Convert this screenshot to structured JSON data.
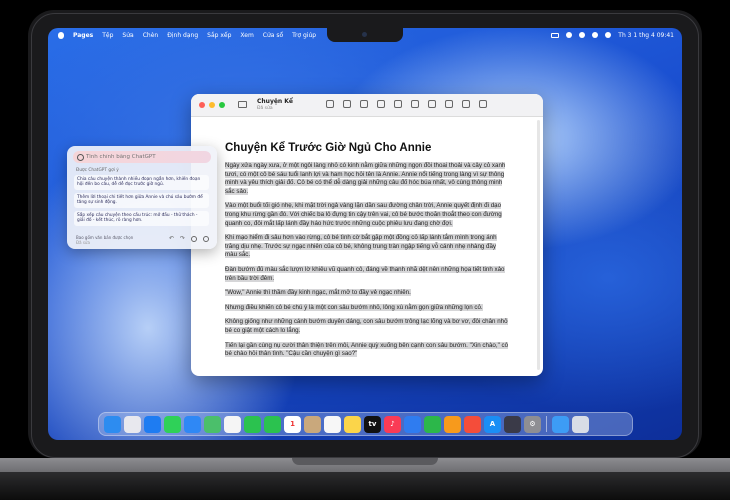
{
  "menubar": {
    "app": "Pages",
    "items": [
      "Tệp",
      "Sửa",
      "Chèn",
      "Định dạng",
      "Sắp xếp",
      "Xem",
      "Cửa sổ",
      "Trợ giúp"
    ],
    "clock": "Th 3 1 thg 4  09:41"
  },
  "window": {
    "title": "Chuyện Kể",
    "subtitle": "Đã sửa",
    "heading": "Chuyện Kể Trước Giờ Ngủ Cho Annie",
    "paragraphs": [
      "Ngày xửa ngày xưa, ở một ngôi làng nhỏ có kinh nằm giữa những ngọn đồi thoai thoải và cây cỏ xanh tươi, có một cô bé sáu tuổi lanh lợi và ham học hỏi tên là Annie. Annie nổi tiếng trong làng vì sự thông minh và yêu thích giải đố. Cô bé có thể dễ dàng giải những câu đố hóc búa nhất, vô cùng thông minh sắc sảo.",
      "Vào một buổi tối gió nhẹ, khi mặt trời ngả vàng lặn dần sau đường chân trời, Annie quyết định đi dạo trong khu rừng gần đó. Với chiếc ba lô đựng tin cậy trên vai, cô bé bước thoăn thoắt theo con đường quanh co, đôi mắt lấp lánh đầy háo hức trước những cuộc phiêu lưu đang chờ đợi.",
      "Khi mạo hiểm đi sâu hơn vào rừng, cô bé tình cờ bắt gặp một đồng cỏ lấp lánh tắm mình trong ánh trăng dịu nhẹ. Trước sự ngạc nhiên của cô bé, không trung tràn ngập tiếng vỗ cánh nhẹ nhàng đầy màu sắc.",
      "Đàn bướm đủ màu sắc lượn lờ khiêu vũ quanh cô, đáng về thanh nhã dệt nên những họa tiết tinh xảo trên bầu trời đêm.",
      "\"Wow,\" Annie thì thầm đầy kinh ngạc, mắt mở to đầy vẻ ngạc nhiên.",
      "Nhưng điều khiến cô bé chú ý là một con sâu bướm nhỏ, lông xù nằm gọn giữa những lọn cỏ.",
      "Không giống như những cánh bướm duyên dáng, con sâu bướm trông lạc lõng và bơ vơ, đôi chân nhỏ bé co giật một cách lo lắng.",
      "Tiến lại gần cùng nụ cười thân thiện trên môi, Annie quỳ xuống bên cạnh con sâu bướm. \"Xin chào,\" cô bé chào hỏi thân tình. \"Cậu cần chuyện gì sao?\""
    ]
  },
  "writing_tools": {
    "placeholder": "Tinh chỉnh bằng ChatGPT",
    "suggested_label": "Được ChatGPT gợi ý",
    "suggestions": [
      "Chia câu chuyện thành nhiều đoạn ngắn hơn, khiến đoạn hội đến bo câu, dễ dễ đọc trước giờ ngủ.",
      "Thêm lời thoại chi tiết hơn giữa Annie và chú sâu bướm để tăng sự sinh động.",
      "Sắp xếp câu chuyện theo cấu trúc: mở đầu - thử thách - giải đố - kết thúc, rõ ràng hơn."
    ],
    "footer": "Bao gồm văn bản được chọn",
    "footer_sub": "Đã sửa"
  },
  "dock": {
    "apps": [
      {
        "name": "finder",
        "color": "#2d8cf0",
        "glyph": ""
      },
      {
        "name": "launchpad",
        "color": "#e8e8ee",
        "glyph": ""
      },
      {
        "name": "safari",
        "color": "#1e7cf2",
        "glyph": ""
      },
      {
        "name": "messages",
        "color": "#2fd158",
        "glyph": ""
      },
      {
        "name": "mail",
        "color": "#2f88f5",
        "glyph": ""
      },
      {
        "name": "maps",
        "color": "#4bbf6b",
        "glyph": ""
      },
      {
        "name": "photos",
        "color": "#f5f5f5",
        "glyph": ""
      },
      {
        "name": "facetime",
        "color": "#2bc24f",
        "glyph": ""
      },
      {
        "name": "phone",
        "color": "#2bc24f",
        "glyph": ""
      },
      {
        "name": "calendar",
        "color": "#ffffff",
        "glyph": "1"
      },
      {
        "name": "contacts",
        "color": "#c9a87c",
        "glyph": ""
      },
      {
        "name": "reminders",
        "color": "#f7f7f7",
        "glyph": ""
      },
      {
        "name": "notes",
        "color": "#fbd54a",
        "glyph": ""
      },
      {
        "name": "tv",
        "color": "#111111",
        "glyph": "tv"
      },
      {
        "name": "music",
        "color": "#fa3b55",
        "glyph": "♪"
      },
      {
        "name": "keynote",
        "color": "#2f7cf0",
        "glyph": ""
      },
      {
        "name": "numbers",
        "color": "#2cb74a",
        "glyph": ""
      },
      {
        "name": "pages",
        "color": "#f79a1c",
        "glyph": ""
      },
      {
        "name": "instruments",
        "color": "#f44d3a",
        "glyph": ""
      },
      {
        "name": "app-store",
        "color": "#1a8ef5",
        "glyph": "A"
      },
      {
        "name": "iphone-mirroring",
        "color": "#3a3a48",
        "glyph": ""
      },
      {
        "name": "system-settings",
        "color": "#8e8e93",
        "glyph": "⚙"
      },
      {
        "name": "downloads-folder",
        "color": "#3d9cf5",
        "glyph": ""
      },
      {
        "name": "trash",
        "color": "#d8dde6",
        "glyph": ""
      }
    ]
  }
}
